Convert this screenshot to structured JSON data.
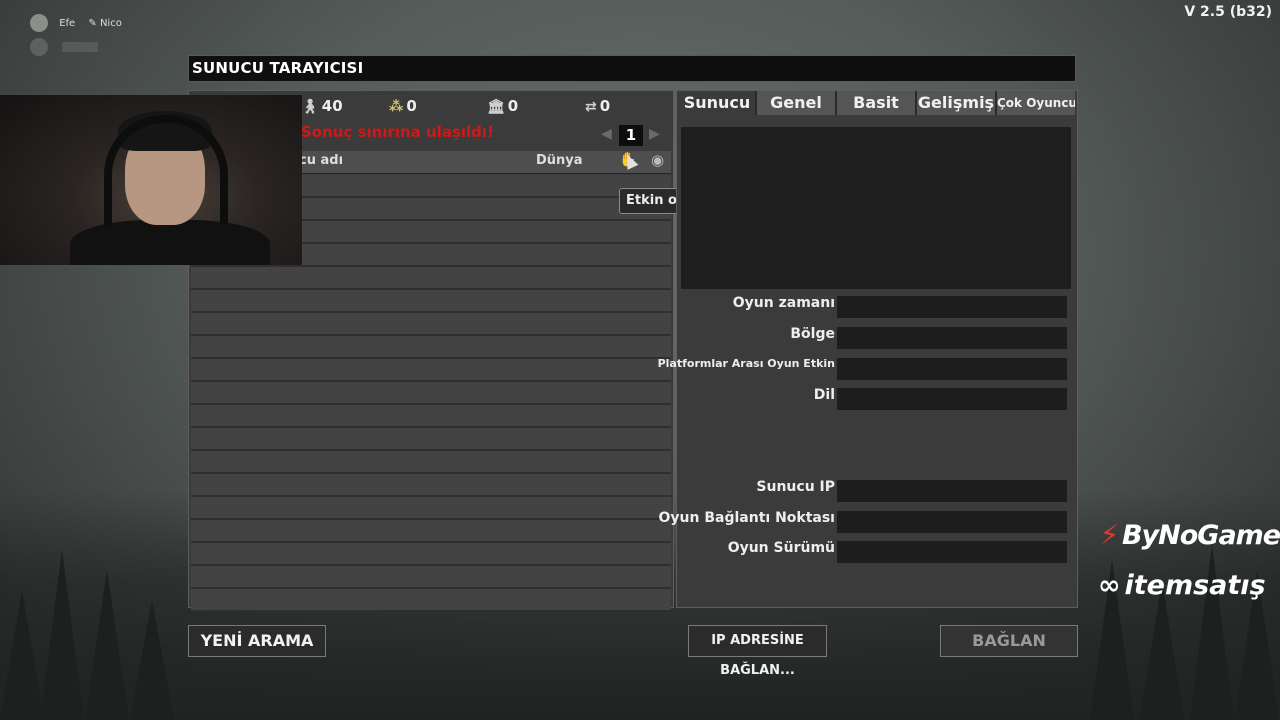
{
  "app": {
    "version": "V 2.5 (b32)",
    "title": "SUNUCU TARAYICISI"
  },
  "players": {
    "user1": "Efe",
    "user2": "Nico"
  },
  "stats": {
    "players": "40",
    "friends": "0",
    "dedicated": "0",
    "crossplay": "0"
  },
  "limit_message": "Sonuç sınırına ulaşıldı!",
  "pager": {
    "page": "1"
  },
  "columns": {
    "name": "cu adı",
    "world": "Dünya"
  },
  "tooltip": "Etkin oyuncu sayısı",
  "tabs": [
    "Sunucu",
    "Genel",
    "Basit",
    "Gelişmiş",
    "Çok Oyunculu"
  ],
  "fields": {
    "game_time": "Oyun zamanı",
    "region": "Bölge",
    "crossplay": "Platformlar Arası Oyun Etkin",
    "language": "Dil",
    "server_ip": "Sunucu IP",
    "game_port": "Oyun Bağlantı Noktası",
    "game_version": "Oyun Sürümü"
  },
  "buttons": {
    "new_search": "YENİ ARAMA",
    "connect_ip": "IP ADRESİNE BAĞLAN...",
    "connect": "BAĞLAN"
  },
  "brands": {
    "b1": "ByNoGame",
    "b2": "itemsatış"
  }
}
